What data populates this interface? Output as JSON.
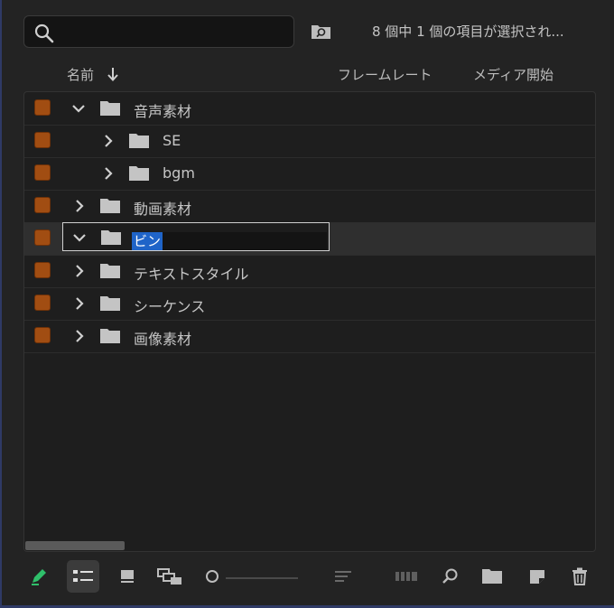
{
  "search": {
    "value": "",
    "placeholder": ""
  },
  "status_text": "8 個中 1 個の項目が選択され...",
  "columns": {
    "name": "名前",
    "frame_rate": "フレームレート",
    "media_start": "メディア開始"
  },
  "label_color": "#a14d12",
  "rows": [
    {
      "name": "音声素材",
      "expanded": true,
      "indent": 0
    },
    {
      "name": "SE",
      "expanded": false,
      "indent": 1
    },
    {
      "name": "bgm",
      "expanded": false,
      "indent": 1
    },
    {
      "name": "動画素材",
      "expanded": false,
      "indent": 0
    },
    {
      "name": "ビン",
      "expanded": true,
      "indent": 0,
      "selected": true,
      "editing": true
    },
    {
      "name": "テキストスタイル",
      "expanded": false,
      "indent": 0
    },
    {
      "name": "シーケンス",
      "expanded": false,
      "indent": 0
    },
    {
      "name": "画像素材",
      "expanded": false,
      "indent": 0
    }
  ],
  "toolbar": {
    "icons": [
      "pencil-icon",
      "list-view-icon",
      "icon-view-icon",
      "freeform-view-icon",
      "zoom-slider",
      "sort-icon",
      "automate-sequence-icon",
      "find-icon",
      "new-bin-icon",
      "new-item-icon",
      "trash-icon"
    ]
  }
}
